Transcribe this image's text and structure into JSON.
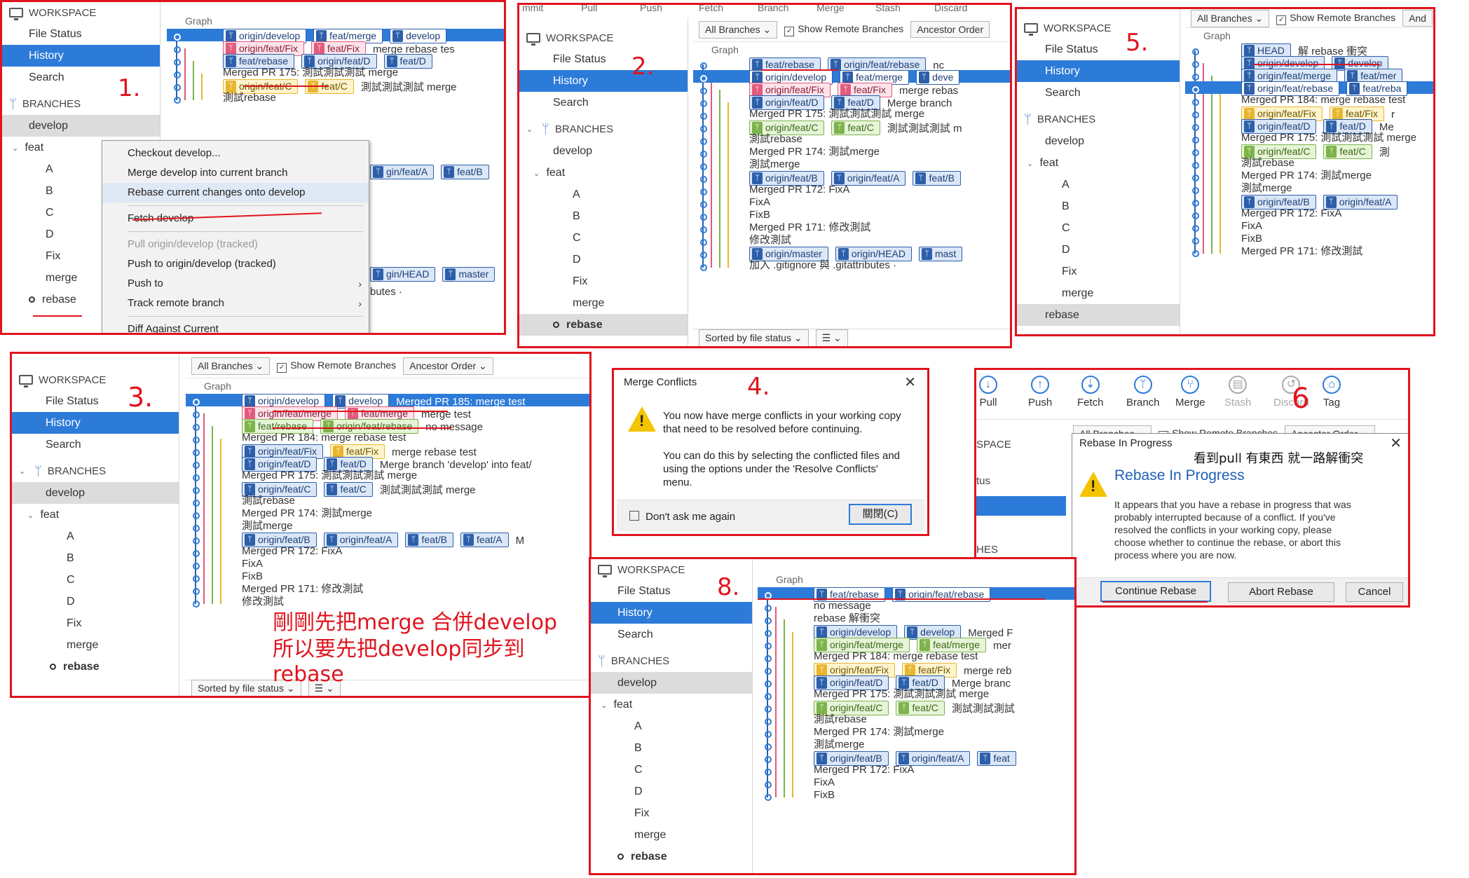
{
  "common": {
    "workspace": "WORKSPACE",
    "file_status": "File Status",
    "history": "History",
    "search": "Search",
    "branches": "BRANCHES",
    "develop": "develop",
    "feat": "feat",
    "A": "A",
    "B": "B",
    "C": "C",
    "D": "D",
    "Fix": "Fix",
    "merge": "merge",
    "rebase": "rebase",
    "graph": "Graph",
    "all_branches": "All Branches",
    "show_remote": "Show Remote Branches",
    "ancestor": "Ancestor Order",
    "sorted": "Sorted by file status"
  },
  "annotations": {
    "a1": "1.",
    "a2": "2.",
    "a3": "3.",
    "a4": "4.",
    "a5": "5.",
    "a6": "6",
    "a8": "8.",
    "note_line1": "剛剛先把merge 合併develop",
    "note_line2": "所以要先把develop同步到rebase",
    "pull_note": "看到pull 有東西 就一路解衝突"
  },
  "p1": {
    "rows": [
      {
        "tags": [
          [
            "blue",
            "origin/develop"
          ],
          [
            "blue",
            "feat/merge"
          ],
          [
            "blue",
            "develop"
          ]
        ],
        "msg": ""
      },
      {
        "tags": [
          [
            "pink",
            "origin/feat/Fix"
          ],
          [
            "pink",
            "feat/Fix"
          ]
        ],
        "msg": "merge rebase tes"
      },
      {
        "tags": [
          [
            "blue",
            "feat/rebase"
          ],
          [
            "blue",
            "origin/feat/D"
          ],
          [
            "blue",
            "feat/D"
          ]
        ],
        "msg": ""
      },
      {
        "tags": [],
        "msg": "Merged PR 175: 測試測試測試 merge"
      },
      {
        "tags": [
          [
            "yellow",
            "origin/feat/C"
          ],
          [
            "yellow",
            "feat/C"
          ]
        ],
        "msg": "測試測試測試 merge"
      },
      {
        "tags": [],
        "msg": "測試rebase"
      }
    ],
    "ctx": {
      "i1": "Checkout develop...",
      "i2": "Merge develop into current branch",
      "i3": "Rebase current changes onto develop",
      "i4": "Fetch develop",
      "i5": "Pull origin/develop (tracked)",
      "i6": "Push to origin/develop (tracked)",
      "i7": "Push to",
      "i8": "Track remote branch",
      "i9": "Diff Against Current"
    },
    "bg": {
      "b1": "gin/feat/A",
      "b2": "feat/B",
      "b3": "gin/HEAD",
      "b4": "master",
      "b5": "butes ·"
    }
  },
  "p2": {
    "toolbar_partial": [
      "mmit",
      "Pull",
      "Push",
      "Fetch",
      "Branch",
      "Merge",
      "Stash",
      "Discard"
    ],
    "rows": [
      {
        "tags": [
          [
            "blue",
            "feat/rebase"
          ],
          [
            "blue",
            "origin/feat/rebase"
          ]
        ],
        "msg": "nc"
      },
      {
        "tags": [
          [
            "blue",
            "origin/develop"
          ],
          [
            "blue",
            "feat/merge"
          ],
          [
            "blue",
            "deve"
          ]
        ],
        "msg": ""
      },
      {
        "tags": [
          [
            "pink",
            "origin/feat/Fix"
          ],
          [
            "pink",
            "feat/Fix"
          ]
        ],
        "msg": "merge rebas"
      },
      {
        "tags": [
          [
            "blue",
            "origin/feat/D"
          ],
          [
            "blue",
            "feat/D"
          ]
        ],
        "msg": "Merge branch"
      },
      {
        "tags": [],
        "msg": "Merged PR 175: 測試測試測試 merge"
      },
      {
        "tags": [
          [
            "green",
            "origin/feat/C"
          ],
          [
            "green",
            "feat/C"
          ]
        ],
        "msg": "測試測試測試 m"
      },
      {
        "tags": [],
        "msg": "測試rebase"
      },
      {
        "tags": [],
        "msg": "Merged PR 174: 測試merge"
      },
      {
        "tags": [],
        "msg": "測試merge"
      },
      {
        "tags": [
          [
            "blue",
            "origin/feat/B"
          ],
          [
            "blue",
            "origin/feat/A"
          ],
          [
            "blue",
            "feat/B"
          ]
        ],
        "msg": ""
      },
      {
        "tags": [],
        "msg": "Merged PR 172: FixA"
      },
      {
        "tags": [],
        "msg": "FixA"
      },
      {
        "tags": [],
        "msg": "FixB"
      },
      {
        "tags": [],
        "msg": "Merged PR 171: 修改測試"
      },
      {
        "tags": [],
        "msg": "修改測試"
      },
      {
        "tags": [
          [
            "blue",
            "origin/master"
          ],
          [
            "blue",
            "origin/HEAD"
          ],
          [
            "blue",
            "mast"
          ]
        ],
        "msg": ""
      },
      {
        "tags": [],
        "msg": "加入 .gitignore 與 .gitattributes ·"
      }
    ]
  },
  "p3": {
    "rows": [
      {
        "tags": [
          [
            "blue",
            "HEAD"
          ]
        ],
        "msg": "解 rebase 衝突"
      },
      {
        "tags": [
          [
            "blue",
            "origin/develop"
          ],
          [
            "blue",
            "develop"
          ]
        ],
        "msg": ""
      },
      {
        "tags": [
          [
            "blue",
            "origin/feat/merge"
          ],
          [
            "blue",
            "feat/mer"
          ]
        ],
        "msg": ""
      },
      {
        "tags": [
          [
            "blue",
            "origin/feat/rebase"
          ],
          [
            "blue",
            "feat/reba"
          ]
        ],
        "msg": ""
      },
      {
        "tags": [],
        "msg": "Merged PR 184: merge rebase test"
      },
      {
        "tags": [
          [
            "yellow",
            "origin/feat/Fix"
          ],
          [
            "yellow",
            "feat/Fix"
          ]
        ],
        "msg": "r"
      },
      {
        "tags": [
          [
            "blue",
            "origin/feat/D"
          ],
          [
            "blue",
            "feat/D"
          ]
        ],
        "msg": "Me"
      },
      {
        "tags": [],
        "msg": "Merged PR 175: 測試測試測試 merge"
      },
      {
        "tags": [
          [
            "green",
            "origin/feat/C"
          ],
          [
            "green",
            "feat/C"
          ]
        ],
        "msg": "測"
      },
      {
        "tags": [],
        "msg": "測試rebase"
      },
      {
        "tags": [],
        "msg": "Merged PR 174: 測試merge"
      },
      {
        "tags": [],
        "msg": "測試merge"
      },
      {
        "tags": [
          [
            "blue",
            "origin/feat/B"
          ],
          [
            "blue",
            "origin/feat/A"
          ]
        ],
        "msg": ""
      },
      {
        "tags": [],
        "msg": "Merged PR 172: FixA"
      },
      {
        "tags": [],
        "msg": "FixA"
      },
      {
        "tags": [],
        "msg": "FixB"
      },
      {
        "tags": [],
        "msg": "Merged PR 171: 修改測試"
      }
    ],
    "show_remote_partial": "Show Remote Branches",
    "and": "And"
  },
  "p4": {
    "rows": [
      {
        "tags": [
          [
            "blue",
            "origin/develop"
          ],
          [
            "blue",
            "develop"
          ]
        ],
        "msg": "Merged PR 185: merge test"
      },
      {
        "tags": [
          [
            "pink",
            "origin/feat/merge"
          ],
          [
            "pink",
            "feat/merge"
          ]
        ],
        "msg": "merge test"
      },
      {
        "tags": [
          [
            "green",
            "feat/rebase"
          ],
          [
            "green",
            "origin/feat/rebase"
          ]
        ],
        "msg": "no message"
      },
      {
        "tags": [],
        "msg": "Merged PR 184: merge rebase test"
      },
      {
        "tags": [
          [
            "blue",
            "origin/feat/Fix"
          ],
          [
            "yellow",
            "feat/Fix"
          ]
        ],
        "msg": "merge rebase test"
      },
      {
        "tags": [
          [
            "blue",
            "origin/feat/D"
          ],
          [
            "blue",
            "feat/D"
          ]
        ],
        "msg": "Merge branch 'develop' into feat/"
      },
      {
        "tags": [],
        "msg": "Merged PR 175: 測試測試測試 merge"
      },
      {
        "tags": [
          [
            "blue",
            "origin/feat/C"
          ],
          [
            "blue",
            "feat/C"
          ]
        ],
        "msg": "測試測試測試 merge"
      },
      {
        "tags": [],
        "msg": "測試rebase"
      },
      {
        "tags": [],
        "msg": "Merged PR 174: 測試merge"
      },
      {
        "tags": [],
        "msg": "測試merge"
      },
      {
        "tags": [
          [
            "blue",
            "origin/feat/B"
          ],
          [
            "blue",
            "origin/feat/A"
          ],
          [
            "blue",
            "feat/B"
          ],
          [
            "blue",
            "feat/A"
          ]
        ],
        "msg": "M"
      },
      {
        "tags": [],
        "msg": "Merged PR 172: FixA"
      },
      {
        "tags": [],
        "msg": "FixA"
      },
      {
        "tags": [],
        "msg": "FixB"
      },
      {
        "tags": [],
        "msg": "Merged PR 171: 修改測試"
      },
      {
        "tags": [],
        "msg": "修改測試"
      }
    ]
  },
  "conflict": {
    "title": "Merge Conflicts",
    "line1": "You now have merge conflicts in your working copy",
    "line2": "that need to be resolved before continuing.",
    "line3": "You can do this by selecting the conflicted files and",
    "line4": "using the options under the 'Resolve Conflicts'",
    "line5": "menu.",
    "dont_ask": "Don't ask me again",
    "close": "關閉(C)"
  },
  "p6": {
    "toolbar": [
      "Pull",
      "Push",
      "Fetch",
      "Branch",
      "Merge",
      "Stash",
      "Discard",
      "Tag"
    ],
    "side_partial": [
      "SPACE",
      "tus",
      "HES"
    ],
    "all_branches": "All Branches",
    "show_remote": "Show Remote Branches",
    "ancestor": "Ancestor Order",
    "rip_title": "Rebase In Progress",
    "rip_heading": "Rebase In Progress",
    "rip_l1": "It appears that you have a rebase in progress that was",
    "rip_l2": "probably interrupted because of a conflict. If you've",
    "rip_l3": "resolved the conflicts in your working copy, please",
    "rip_l4": "choose whether to continue the rebase, or abort this",
    "rip_l5": "process where you are now.",
    "continue": "Continue Rebase",
    "abort": "Abort Rebase",
    "cancel": "Cancel"
  },
  "p8": {
    "rows": [
      {
        "tags": [
          [
            "blue",
            "feat/rebase"
          ],
          [
            "blue",
            "origin/feat/rebase"
          ]
        ],
        "msg": ""
      },
      {
        "tags": [],
        "msg": "no message"
      },
      {
        "tags": [],
        "msg": "rebase 解衝突"
      },
      {
        "tags": [
          [
            "blue",
            "origin/develop"
          ],
          [
            "blue",
            "develop"
          ]
        ],
        "msg": "Merged F"
      },
      {
        "tags": [
          [
            "green",
            "origin/feat/merge"
          ],
          [
            "green",
            "feat/merge"
          ]
        ],
        "msg": "mer"
      },
      {
        "tags": [],
        "msg": "Merged PR 184: merge rebase test"
      },
      {
        "tags": [
          [
            "yellow",
            "origin/feat/Fix"
          ],
          [
            "yellow",
            "feat/Fix"
          ]
        ],
        "msg": "merge reb"
      },
      {
        "tags": [
          [
            "blue",
            "origin/feat/D"
          ],
          [
            "blue",
            "feat/D"
          ]
        ],
        "msg": "Merge branc"
      },
      {
        "tags": [],
        "msg": "Merged PR 175: 測試測試測試 merge"
      },
      {
        "tags": [
          [
            "green",
            "origin/feat/C"
          ],
          [
            "green",
            "feat/C"
          ]
        ],
        "msg": "測試測試測試"
      },
      {
        "tags": [],
        "msg": "測試rebase"
      },
      {
        "tags": [],
        "msg": "Merged PR 174: 測試merge"
      },
      {
        "tags": [],
        "msg": "測試merge"
      },
      {
        "tags": [
          [
            "blue",
            "origin/feat/B"
          ],
          [
            "blue",
            "origin/feat/A"
          ],
          [
            "blue",
            "feat"
          ]
        ],
        "msg": ""
      },
      {
        "tags": [],
        "msg": "Merged PR 172: FixA"
      },
      {
        "tags": [],
        "msg": "FixA"
      },
      {
        "tags": [],
        "msg": "FixB"
      }
    ]
  }
}
